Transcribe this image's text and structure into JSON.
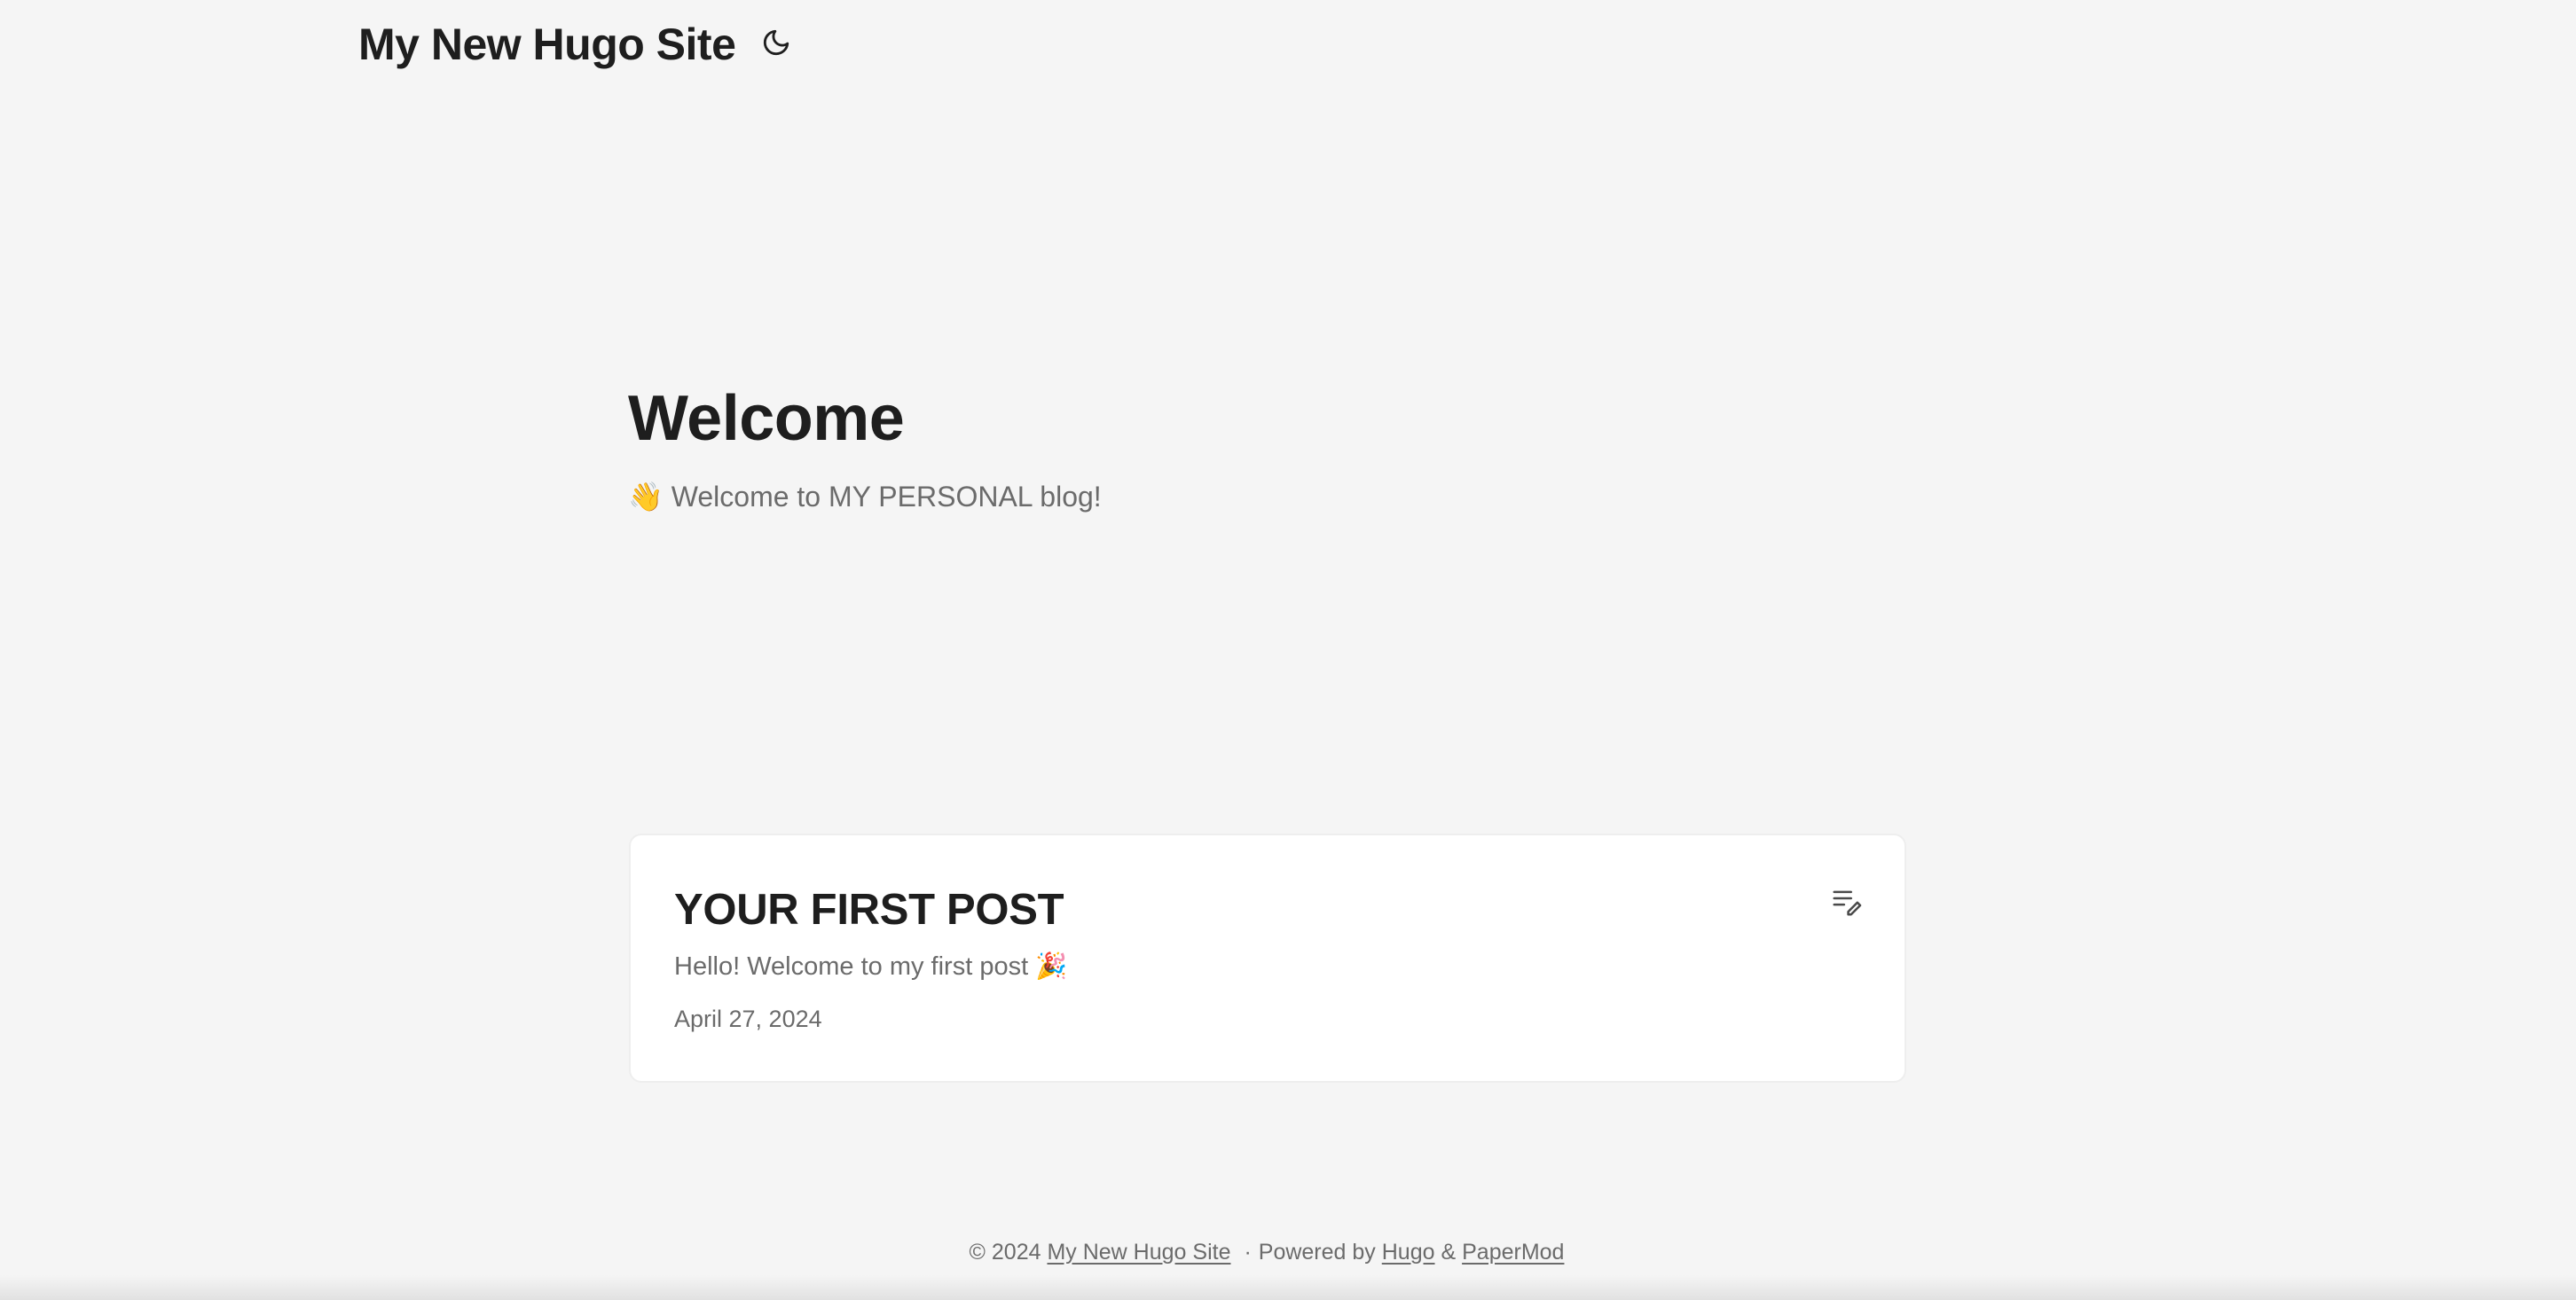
{
  "header": {
    "site_title": "My New Hugo Site",
    "theme_toggle_icon": "moon-icon"
  },
  "hero": {
    "title": "Welcome",
    "subtitle": "👋 Welcome to MY PERSONAL blog!"
  },
  "posts": [
    {
      "title": "YOUR FIRST POST",
      "summary": "Hello! Welcome to my first post 🎉",
      "date": "April 27, 2024",
      "action_icon": "edit-list-icon"
    }
  ],
  "footer": {
    "copyright": "© 2024",
    "site_link": "My New Hugo Site",
    "separator": "·",
    "powered_by": "Powered by",
    "hugo_link": "Hugo",
    "ampersand": "&",
    "theme_link": "PaperMod"
  },
  "colors": {
    "background": "#f5f5f5",
    "card": "#ffffff",
    "text_primary": "#1e1e1e",
    "text_secondary": "#6b6b6b"
  }
}
